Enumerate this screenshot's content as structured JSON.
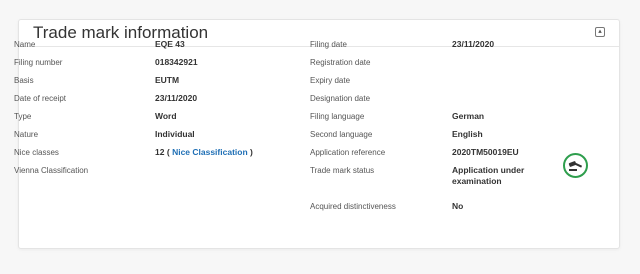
{
  "card": {
    "title": "Trade mark information",
    "collapse_symbol": "▴"
  },
  "left": {
    "name_label": "Name",
    "name_value": "EQE 43",
    "filing_number_label": "Filing number",
    "filing_number_value": "018342921",
    "basis_label": "Basis",
    "basis_value": "EUTM",
    "date_of_receipt_label": "Date of receipt",
    "date_of_receipt_value": "23/11/2020",
    "type_label": "Type",
    "type_value": "Word",
    "nature_label": "Nature",
    "nature_value": "Individual",
    "nice_classes_label": "Nice classes",
    "nice_classes_count": "12",
    "nice_open": "(",
    "nice_link": "Nice Classification",
    "nice_close": ")",
    "vienna_label": "Vienna Classification"
  },
  "right": {
    "filing_date_label": "Filing date",
    "filing_date_value": "23/11/2020",
    "registration_date_label": "Registration date",
    "expiry_date_label": "Expiry date",
    "designation_date_label": "Designation date",
    "filing_language_label": "Filing language",
    "filing_language_value": "German",
    "second_language_label": "Second language",
    "second_language_value": "English",
    "application_reference_label": "Application reference",
    "application_reference_value": "2020TM50019EU",
    "status_label": "Trade mark status",
    "status_value_line1": "Application under",
    "status_value_line2": "examination",
    "acquired_label": "Acquired distinctiveness",
    "acquired_value": "No"
  },
  "status_icon": {
    "icon": "gavel-icon",
    "ring_color": "#2e9e4d"
  }
}
